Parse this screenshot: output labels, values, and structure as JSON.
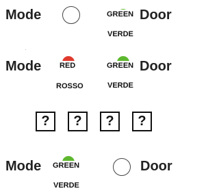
{
  "rows": [
    {
      "mode_label": "Mode",
      "left_state": "off",
      "right_light": {
        "label": "GREEN",
        "translation": "VERDE",
        "color": "#5eb82f"
      },
      "door_label": "Door"
    },
    {
      "mode_label": "Mode",
      "left_light": {
        "label": "RED",
        "translation": "ROSSO",
        "color": "#e03a2e"
      },
      "right_light": {
        "label": "GREEN",
        "translation": "VERDE",
        "color": "#5eb82f"
      },
      "door_label": "Door"
    },
    {
      "mode_label": "Mode",
      "left_light": {
        "label": "GREEN",
        "translation": "VERDE",
        "color": "#5eb82f"
      },
      "right_state": "off",
      "door_label": "Door"
    }
  ],
  "puzzle": {
    "boxes": [
      "?",
      "?",
      "?",
      "?"
    ]
  }
}
